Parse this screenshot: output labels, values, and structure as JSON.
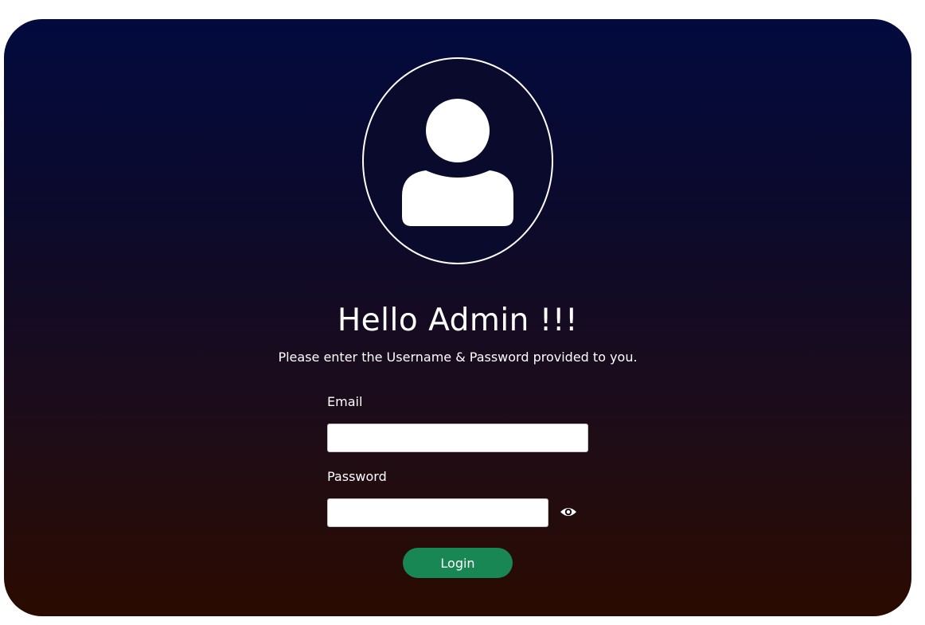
{
  "header": {
    "title": "Hello Admin !!!",
    "subtitle": "Please enter the Username & Password provided to you."
  },
  "form": {
    "email_label": "Email",
    "email_value": "",
    "password_label": "Password",
    "password_value": "",
    "show_password_icon": "eye-icon",
    "login_label": "Login"
  },
  "avatar": {
    "icon": "user-icon"
  },
  "colors": {
    "gradient_top": "#020a3e",
    "gradient_bottom": "#2b0b00",
    "button": "#198754",
    "text": "#ffffff"
  }
}
